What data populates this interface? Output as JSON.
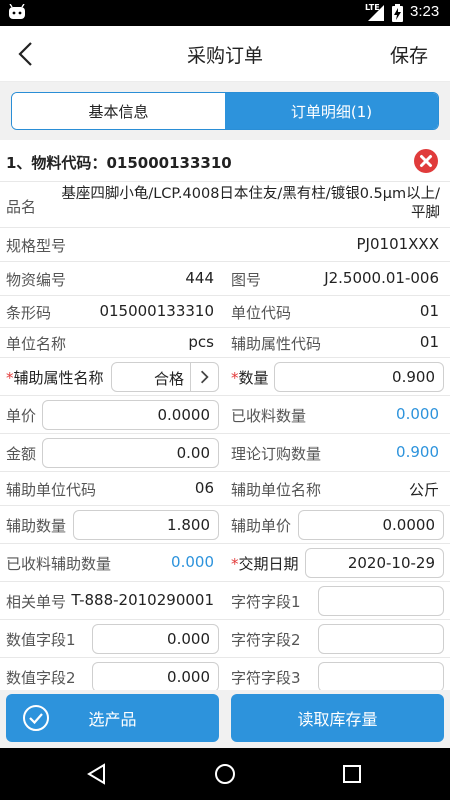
{
  "status_bar": {
    "network": "LTE",
    "time": "3:23"
  },
  "app_bar": {
    "title": "采购订单",
    "save_label": "保存"
  },
  "tabs": [
    {
      "label": "基本信息",
      "active": false
    },
    {
      "label": "订单明细(1)",
      "active": true
    }
  ],
  "item": {
    "header_label": "1、物料代码：",
    "material_code": "015000133310",
    "name_label": "品名",
    "name_value": "基座四脚小龟/LCP.4008日本住友/黑有柱/镀银0.5μm以上/平脚",
    "spec_label": "规格型号",
    "spec_value": "PJ0101XXX",
    "material_no_label": "物资编号",
    "material_no_value": "444",
    "drawing_no_label": "图号",
    "drawing_no_value": "J2.5000.01-006",
    "barcode_label": "条形码",
    "barcode_value": "015000133310",
    "unit_code_label": "单位代码",
    "unit_code_value": "01",
    "unit_name_label": "单位名称",
    "unit_name_value": "pcs",
    "aux_attr_code_label": "辅助属性代码",
    "aux_attr_code_value": "01",
    "required_mark": "*",
    "aux_attr_name_label": "辅助属性名称",
    "aux_attr_name_value": "合格",
    "quantity_label": "数量",
    "quantity_value": "0.900",
    "price_label": "单价",
    "price_value": "0.0000",
    "received_qty_label": "已收料数量",
    "received_qty_value": "0.000",
    "amount_label": "金额",
    "amount_value": "0.00",
    "theory_qty_label": "理论订购数量",
    "theory_qty_value": "0.900",
    "aux_unit_code_label": "辅助单位代码",
    "aux_unit_code_value": "06",
    "aux_unit_name_label": "辅助单位名称",
    "aux_unit_name_value": "公斤",
    "aux_qty_label": "辅助数量",
    "aux_qty_value": "1.800",
    "aux_price_label": "辅助单价",
    "aux_price_value": "0.0000",
    "received_aux_qty_label": "已收料辅助数量",
    "received_aux_qty_value": "0.000",
    "delivery_date_label": "交期日期",
    "delivery_date_value": "2020-10-29",
    "related_no_label": "相关单号",
    "related_no_value": "T-888-2010290001",
    "char_field1_label": "字符字段1",
    "char_field1_value": "",
    "num_field1_label": "数值字段1",
    "num_field1_value": "0.000",
    "char_field2_label": "字符字段2",
    "char_field2_value": "",
    "num_field2_label": "数值字段2",
    "num_field2_value": "0.000",
    "char_field3_label": "字符字段3",
    "char_field3_value": ""
  },
  "bottom_bar": {
    "select_product_label": "选产品",
    "read_stock_label": "读取库存量"
  },
  "colors": {
    "accent": "#2d93dc",
    "danger": "#e03b3b",
    "required": "#e23b3b"
  }
}
